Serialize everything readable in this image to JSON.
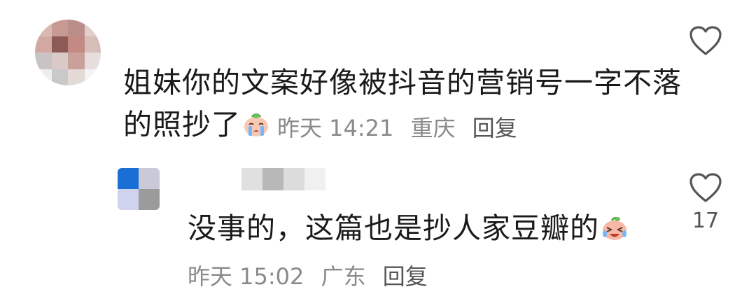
{
  "comments": [
    {
      "text": "姐妹你的文案好像被抖音的营销号一字不落",
      "text_line2": "的照抄了",
      "emoji": "crying-face-emoji",
      "time": "昨天 14:21",
      "location": "重庆",
      "reply_label": "回复",
      "like_icon": "heart-outline-icon",
      "avatar_colors": [
        "#d9b8b2",
        "#c79b94",
        "#ba8f8a",
        "#e2cfca",
        "#d2a8a2",
        "#8c5b55",
        "#c38a83",
        "#d8beb8",
        "#c9c3c3",
        "#d9c9c7",
        "#caa09a",
        "#e6dedd",
        "#eeeeee",
        "#c9c9c9",
        "#e3d9d7",
        "#f3f3f3"
      ]
    },
    {
      "text": "没事的，这篇也是抄人家豆瓣的",
      "emoji": "laughing-crying-emoji",
      "time": "昨天 15:02",
      "location": "广东",
      "reply_label": "回复",
      "like_icon": "heart-outline-icon",
      "like_count": "17",
      "avatar_colors": [
        "#1a6fd6",
        "#c9c9d8",
        "#cfd3ee",
        "#9b9b9b"
      ],
      "username_mask_colors": [
        "#e0e0e0",
        "#b8b8b8",
        "#dcdcdc",
        "#f0f0f0"
      ]
    }
  ]
}
